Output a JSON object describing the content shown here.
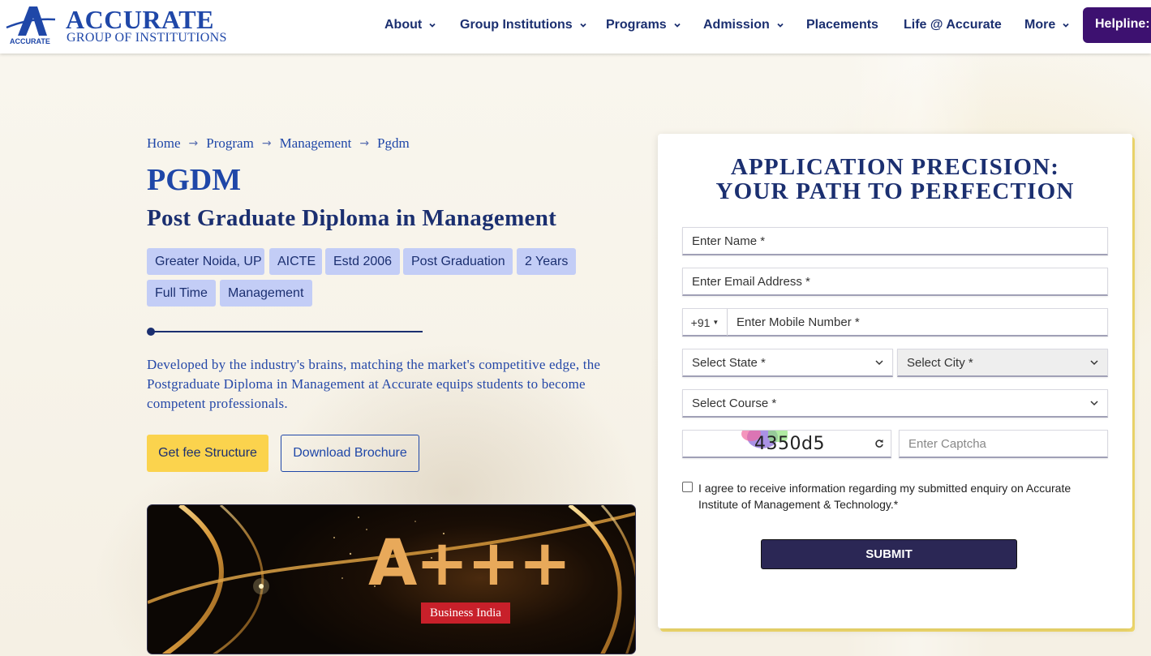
{
  "brand": {
    "name": "ACCURATE",
    "tagline": "GROUP OF INSTITUTIONS",
    "mark_text": "ACCURATE",
    "primary_color": "#1f47a8",
    "accent_color": "#fbd34d",
    "helpline_color": "#3d1170"
  },
  "nav": {
    "items": [
      {
        "label": "About",
        "has_dropdown": true
      },
      {
        "label": "Group Institutions",
        "has_dropdown": true
      },
      {
        "label": "Programs",
        "has_dropdown": true
      },
      {
        "label": "Admission",
        "has_dropdown": true
      },
      {
        "label": "Placements",
        "has_dropdown": false
      },
      {
        "label": "Life @ Accurate",
        "has_dropdown": false
      },
      {
        "label": "More",
        "has_dropdown": true
      }
    ],
    "helpline": "Helpline: +"
  },
  "breadcrumb": [
    "Home",
    "Program",
    "Management",
    "Pgdm"
  ],
  "program": {
    "title": "PGDM",
    "subtitle": "Post Graduate Diploma in Management",
    "tags": [
      "Greater Noida, UP",
      "AICTE",
      "Estd 2006",
      "Post Graduation",
      "2 Years",
      "Full Time",
      "Management"
    ],
    "description": "Developed by the industry's brains, matching the market's competitive edge, the Postgraduate Diploma in Management at Accurate equips students to become competent professionals.",
    "fee_button": "Get fee Structure",
    "brochure_button": "Download Brochure"
  },
  "banner": {
    "rating": "A+++",
    "label": "Business India"
  },
  "form": {
    "title_line1": "APPLICATION PRECISION:",
    "title_line2": "YOUR PATH TO PERFECTION",
    "name_placeholder": "Enter Name *",
    "email_placeholder": "Enter Email Address *",
    "country_code": "+91",
    "mobile_placeholder": "Enter Mobile Number *",
    "state_select": "Select State *",
    "city_select": "Select City *",
    "course_select": "Select Course *",
    "captcha_value": "4350d5",
    "captcha_placeholder": "Enter Captcha",
    "consent_text": "I agree to receive information regarding my submitted enquiry on Accurate Institute of Management & Technology.*",
    "submit_label": "SUBMIT"
  }
}
